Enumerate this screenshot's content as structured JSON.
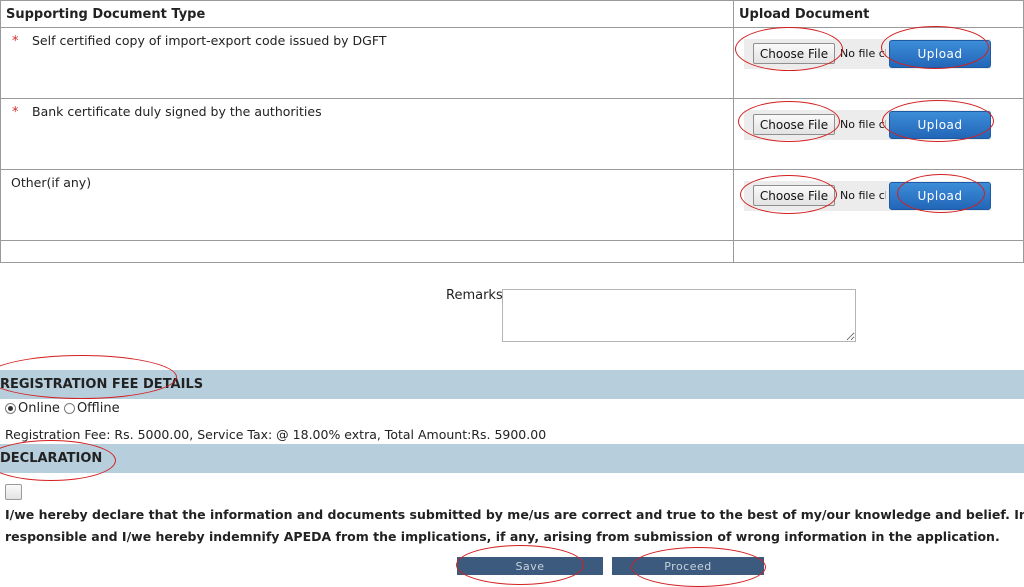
{
  "documents_table": {
    "header_type": "Supporting Document Type",
    "header_upload": "Upload Document",
    "rows": [
      {
        "required_mark": "*",
        "label": "Self certified copy of import-export code issued by DGFT",
        "choose_label": "Choose File",
        "file_status": "No file chosen",
        "upload_label": "Upload"
      },
      {
        "required_mark": "*",
        "label": "Bank certificate duly signed by the authorities",
        "choose_label": "Choose File",
        "file_status": "No file chosen",
        "upload_label": "Upload"
      },
      {
        "required_mark": "",
        "label": "Other(if any)",
        "choose_label": "Choose File",
        "file_status": "No file chosen",
        "upload_label": "Upload"
      }
    ]
  },
  "remarks": {
    "label": "Remarks",
    "value": ""
  },
  "registration_fee": {
    "title": "REGISTRATION FEE DETAILS",
    "options": [
      {
        "label": "Online",
        "selected": true
      },
      {
        "label": "Offline",
        "selected": false
      }
    ],
    "fee_text": "Registration Fee: Rs. 5000.00, Service Tax: @ 18.00% extra, Total Amount:Rs. 5900.00"
  },
  "declaration": {
    "title": "DECLARATION",
    "checked": false,
    "text_line1": "I/we hereby declare that the information and documents submitted by me/us are correct and true to the best of my/our knowledge and belief. Incase, it is found to be false",
    "text_line2": "responsible and I/we hereby indemnify APEDA from the implications, if any, arising from submission of wrong information in the application."
  },
  "actions": {
    "save_label": "Save",
    "proceed_label": "Proceed"
  },
  "colors": {
    "section_bar": "#b7cedd",
    "upload_button": "#2f7bd0",
    "annotation_ring": "#d41f1f",
    "bottom_button": "#3b5a7e"
  }
}
